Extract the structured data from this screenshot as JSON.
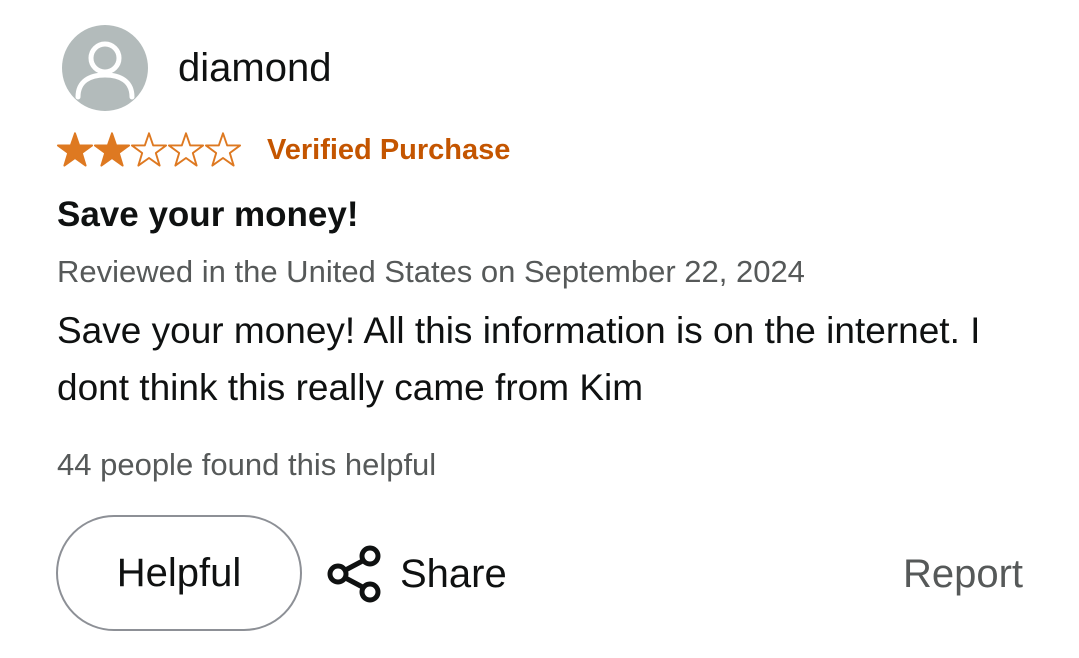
{
  "review": {
    "author": "diamond",
    "rating": 2,
    "rating_max": 5,
    "star_color": "#de7921",
    "verified_label": "Verified Purchase",
    "title": "Save your money!",
    "reviewed_line": "Reviewed in the United States on September 22, 2024",
    "body": "Save your money! All this information is on the internet. I dont think this really came from Kim",
    "helpful_count_text": "44 people found this helpful"
  },
  "actions": {
    "helpful_label": "Helpful",
    "share_label": "Share",
    "report_label": "Report"
  },
  "icons": {
    "avatar": "user-silhouette-icon",
    "share": "share-icon",
    "star_filled": "star-filled-icon",
    "star_empty": "star-outline-icon"
  },
  "colors": {
    "verified": "#c45500",
    "muted_text": "#565959",
    "avatar_bg": "#b3bbbb"
  }
}
